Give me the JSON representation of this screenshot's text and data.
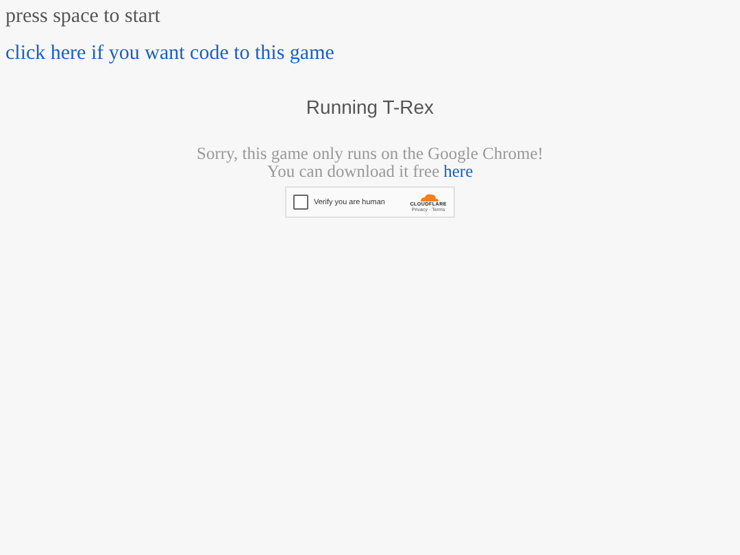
{
  "hint": "press space to start",
  "code_link": "click here if you want code to this game",
  "title": "Running T-Rex",
  "message": {
    "line1": "Sorry, this game only runs on the Google Chrome!",
    "line2": "You can download it free ",
    "link": "here"
  },
  "captcha": {
    "label": "Verify you are human",
    "checked": false,
    "brand": "CLOUDFLARE",
    "privacy": "Privacy",
    "separator": "·",
    "terms": "Terms"
  }
}
